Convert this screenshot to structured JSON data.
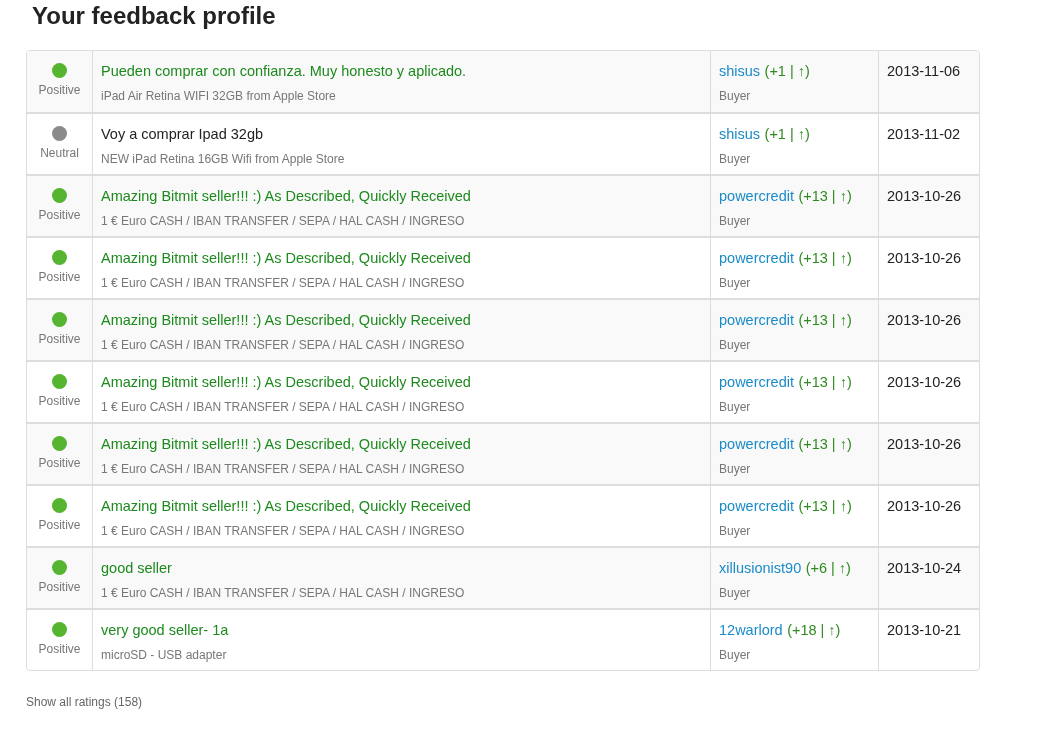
{
  "title": "Your feedback profile",
  "feedback": [
    {
      "kind": "positive",
      "rating_label": "Positive",
      "comment": "Pueden comprar con confianza. Muy honesto y aplicado.",
      "item": "iPad Air Retina WIFI 32GB from Apple Store",
      "user": "shisus",
      "reputation": "(+1 | ↑)",
      "role": "Buyer",
      "date": "2013-11-06"
    },
    {
      "kind": "neutral",
      "rating_label": "Neutral",
      "comment": "Voy a comprar Ipad 32gb",
      "item": "NEW iPad Retina 16GB Wifi from Apple Store",
      "user": "shisus",
      "reputation": "(+1 | ↑)",
      "role": "Buyer",
      "date": "2013-11-02"
    },
    {
      "kind": "positive",
      "rating_label": "Positive",
      "comment": "Amazing Bitmit seller!!! :) As Described, Quickly Received",
      "item": "1 € Euro CASH / IBAN TRANSFER / SEPA / HAL CASH / INGRESO",
      "user": "powercredit",
      "reputation": "(+13 | ↑)",
      "role": "Buyer",
      "date": "2013-10-26"
    },
    {
      "kind": "positive",
      "rating_label": "Positive",
      "comment": "Amazing Bitmit seller!!! :) As Described, Quickly Received",
      "item": "1 € Euro CASH / IBAN TRANSFER / SEPA / HAL CASH / INGRESO",
      "user": "powercredit",
      "reputation": "(+13 | ↑)",
      "role": "Buyer",
      "date": "2013-10-26"
    },
    {
      "kind": "positive",
      "rating_label": "Positive",
      "comment": "Amazing Bitmit seller!!! :) As Described, Quickly Received",
      "item": "1 € Euro CASH / IBAN TRANSFER / SEPA / HAL CASH / INGRESO",
      "user": "powercredit",
      "reputation": "(+13 | ↑)",
      "role": "Buyer",
      "date": "2013-10-26"
    },
    {
      "kind": "positive",
      "rating_label": "Positive",
      "comment": "Amazing Bitmit seller!!! :) As Described, Quickly Received",
      "item": "1 € Euro CASH / IBAN TRANSFER / SEPA / HAL CASH / INGRESO",
      "user": "powercredit",
      "reputation": "(+13 | ↑)",
      "role": "Buyer",
      "date": "2013-10-26"
    },
    {
      "kind": "positive",
      "rating_label": "Positive",
      "comment": "Amazing Bitmit seller!!! :) As Described, Quickly Received",
      "item": "1 € Euro CASH / IBAN TRANSFER / SEPA / HAL CASH / INGRESO",
      "user": "powercredit",
      "reputation": "(+13 | ↑)",
      "role": "Buyer",
      "date": "2013-10-26"
    },
    {
      "kind": "positive",
      "rating_label": "Positive",
      "comment": "Amazing Bitmit seller!!! :) As Described, Quickly Received",
      "item": "1 € Euro CASH / IBAN TRANSFER / SEPA / HAL CASH / INGRESO",
      "user": "powercredit",
      "reputation": "(+13 | ↑)",
      "role": "Buyer",
      "date": "2013-10-26"
    },
    {
      "kind": "positive",
      "rating_label": "Positive",
      "comment": "good seller",
      "item": "1 € Euro CASH / IBAN TRANSFER / SEPA / HAL CASH / INGRESO",
      "user": "xillusionist90",
      "reputation": "(+6 | ↑)",
      "role": "Buyer",
      "date": "2013-10-24"
    },
    {
      "kind": "positive",
      "rating_label": "Positive",
      "comment": "very good seller- 1a",
      "item": "microSD - USB adapter",
      "user": "12warlord",
      "reputation": "(+18 | ↑)",
      "role": "Buyer",
      "date": "2013-10-21"
    }
  ],
  "show_all_link": "Show all ratings (158)"
}
